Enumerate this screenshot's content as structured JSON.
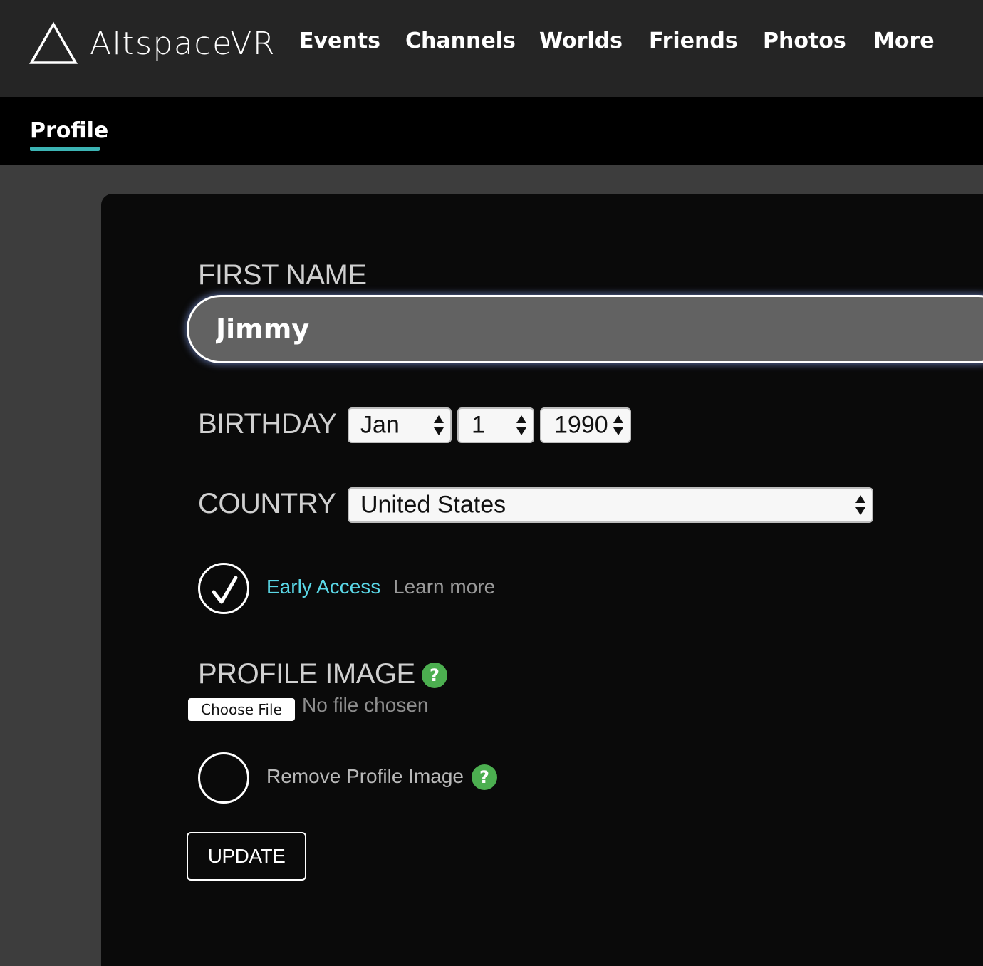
{
  "header": {
    "brand": "AltspaceVR",
    "logo_icon": "triangle-logo-icon",
    "nav": [
      "Events",
      "Channels",
      "Worlds",
      "Friends",
      "Photos",
      "More"
    ]
  },
  "subnav": {
    "active_tab": "Profile",
    "accent_color": "#3cb4b4"
  },
  "form": {
    "first_name_label": "FIRST NAME",
    "first_name_value": "Jimmy",
    "birthday_label": "BIRTHDAY",
    "birthday_month": "Jan",
    "birthday_day": "1",
    "birthday_year": "1990",
    "country_label": "COUNTRY",
    "country_value": "United States",
    "early_access_checked": true,
    "early_access_label": "Early Access",
    "learn_more": "Learn more",
    "profile_image_label": "PROFILE IMAGE",
    "help_glyph": "?",
    "choose_file": "Choose File",
    "file_status": "No file chosen",
    "remove_checked": false,
    "remove_image_label": "Remove Profile Image",
    "update_button": "UPDATE"
  },
  "colors": {
    "link_cyan": "#5ad7e6",
    "help_green": "#4caf50"
  }
}
